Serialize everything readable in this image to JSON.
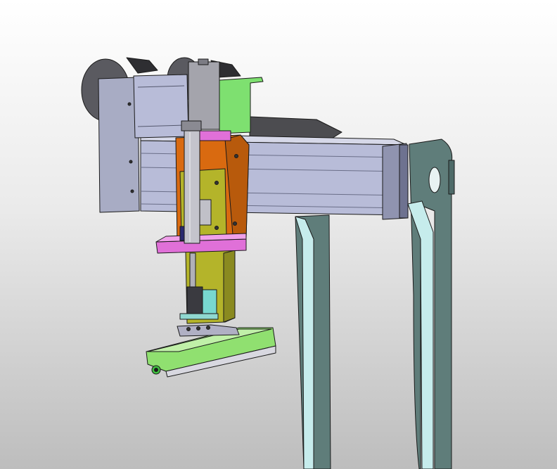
{
  "scene": {
    "background_top": "#ffffff",
    "background_bottom": "#bdbdbd",
    "colors": {
      "frame": "#5f7d7a",
      "frame_highlight": "#c6ecec",
      "beam": "#b8bcd8",
      "motor": "#9094a8",
      "carriage": "#d96a10",
      "slide": "#b4b42a",
      "bracket_pink": "#e070d8",
      "bracket_green": "#7ee070",
      "gripper": "#90e070",
      "cylinder": "#a4a4ac",
      "block_teal": "#78d8d0"
    },
    "parts": [
      "support-frame",
      "linear-beam",
      "servo-motor",
      "vertical-carriage",
      "pneumatic-cylinder",
      "gripper-plate"
    ]
  }
}
